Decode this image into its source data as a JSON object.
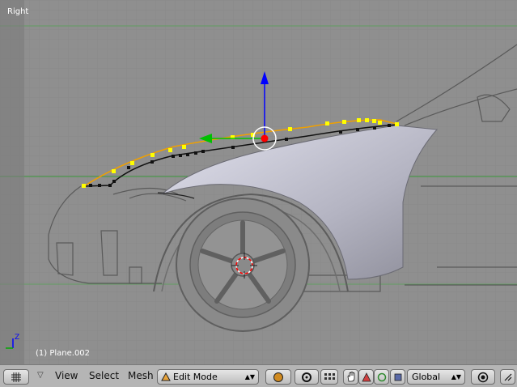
{
  "viewport": {
    "view_name": "Right",
    "object_label": "(1) Plane.002",
    "axis_label": "Z",
    "colors": {
      "background": "#8f8f8f",
      "curve_selected": "#f0a000",
      "vertex_selected": "#ffff00",
      "manip_z": "#0000ff",
      "manip_y": "#00c000",
      "center": "#ff0000",
      "grid_axis": "#3a9a3a"
    }
  },
  "header": {
    "editor_icon": "grid-editor-type-icon",
    "menu": {
      "view": "View",
      "select": "Select",
      "mesh": "Mesh"
    },
    "mode": {
      "label": "Edit Mode",
      "icon": "edit-mode-triangle-icon"
    },
    "orientation": {
      "label": "Global"
    },
    "icons": [
      "viewport-shading-icon",
      "pivot-point-icon",
      "manipulator-toggle-icon",
      "translate-hand-icon",
      "rotate-icon",
      "scale-icon",
      "layers-icon",
      "proportional-edit-icon"
    ]
  }
}
